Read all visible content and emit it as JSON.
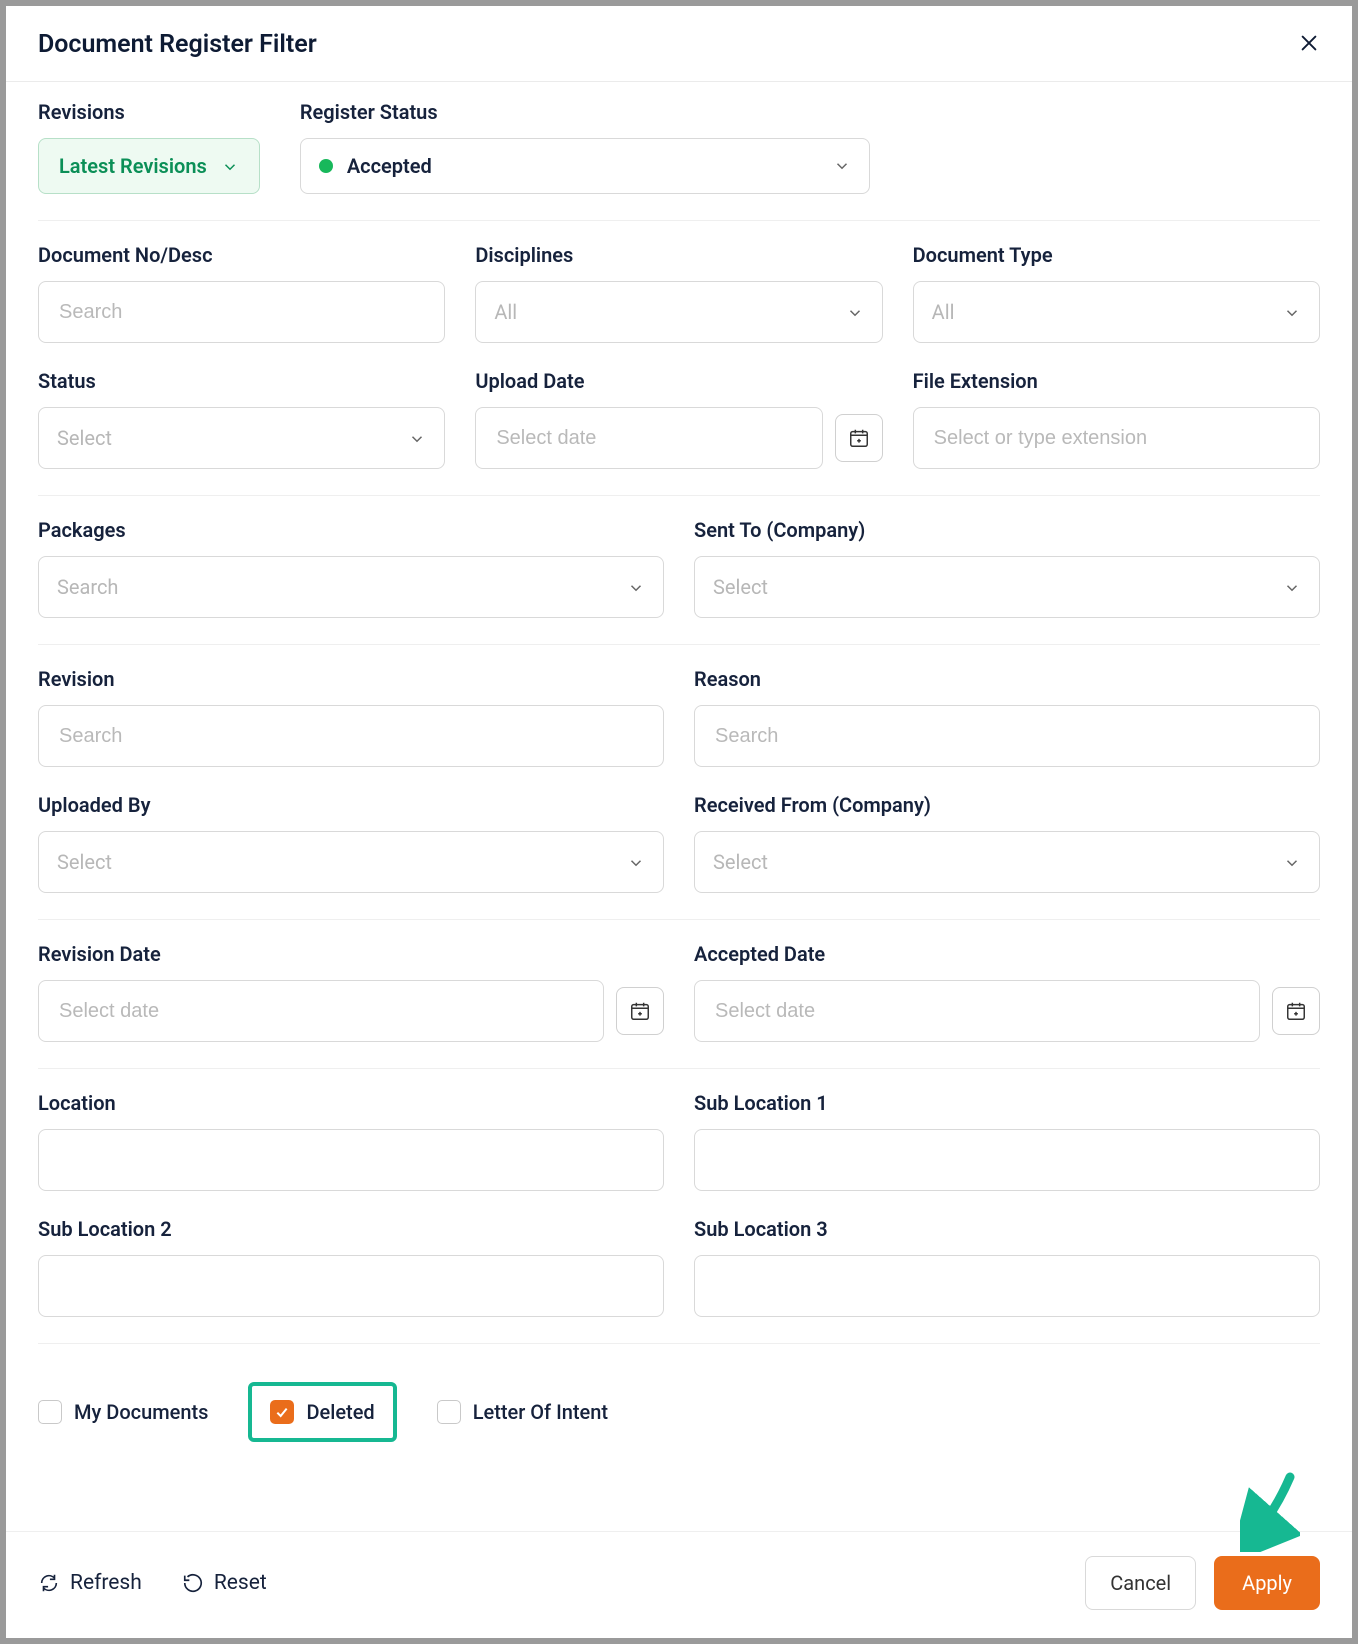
{
  "modal": {
    "title": "Document Register Filter"
  },
  "revisions": {
    "label": "Revisions",
    "value": "Latest Revisions"
  },
  "register_status": {
    "label": "Register Status",
    "value": "Accepted"
  },
  "doc_no": {
    "label": "Document No/Desc",
    "placeholder": "Search"
  },
  "disciplines": {
    "label": "Disciplines",
    "value": "All"
  },
  "doc_type": {
    "label": "Document Type",
    "value": "All"
  },
  "status": {
    "label": "Status",
    "placeholder": "Select"
  },
  "upload_date": {
    "label": "Upload Date",
    "placeholder": "Select date"
  },
  "file_ext": {
    "label": "File Extension",
    "placeholder": "Select or type extension"
  },
  "packages": {
    "label": "Packages",
    "placeholder": "Search"
  },
  "sent_to": {
    "label": "Sent To (Company)",
    "placeholder": "Select"
  },
  "revision": {
    "label": "Revision",
    "placeholder": "Search"
  },
  "reason": {
    "label": "Reason",
    "placeholder": "Search"
  },
  "uploaded_by": {
    "label": "Uploaded By",
    "placeholder": "Select"
  },
  "received_from": {
    "label": "Received From (Company)",
    "placeholder": "Select"
  },
  "revision_date": {
    "label": "Revision Date",
    "placeholder": "Select date"
  },
  "accepted_date": {
    "label": "Accepted Date",
    "placeholder": "Select date"
  },
  "location": {
    "label": "Location"
  },
  "sub_loc_1": {
    "label": "Sub Location 1"
  },
  "sub_loc_2": {
    "label": "Sub Location 2"
  },
  "sub_loc_3": {
    "label": "Sub Location 3"
  },
  "checks": {
    "my_docs": {
      "label": "My Documents",
      "checked": false
    },
    "deleted": {
      "label": "Deleted",
      "checked": true
    },
    "letter_of_intent": {
      "label": "Letter Of Intent",
      "checked": false
    }
  },
  "footer": {
    "refresh": "Refresh",
    "reset": "Reset",
    "cancel": "Cancel",
    "apply": "Apply"
  }
}
